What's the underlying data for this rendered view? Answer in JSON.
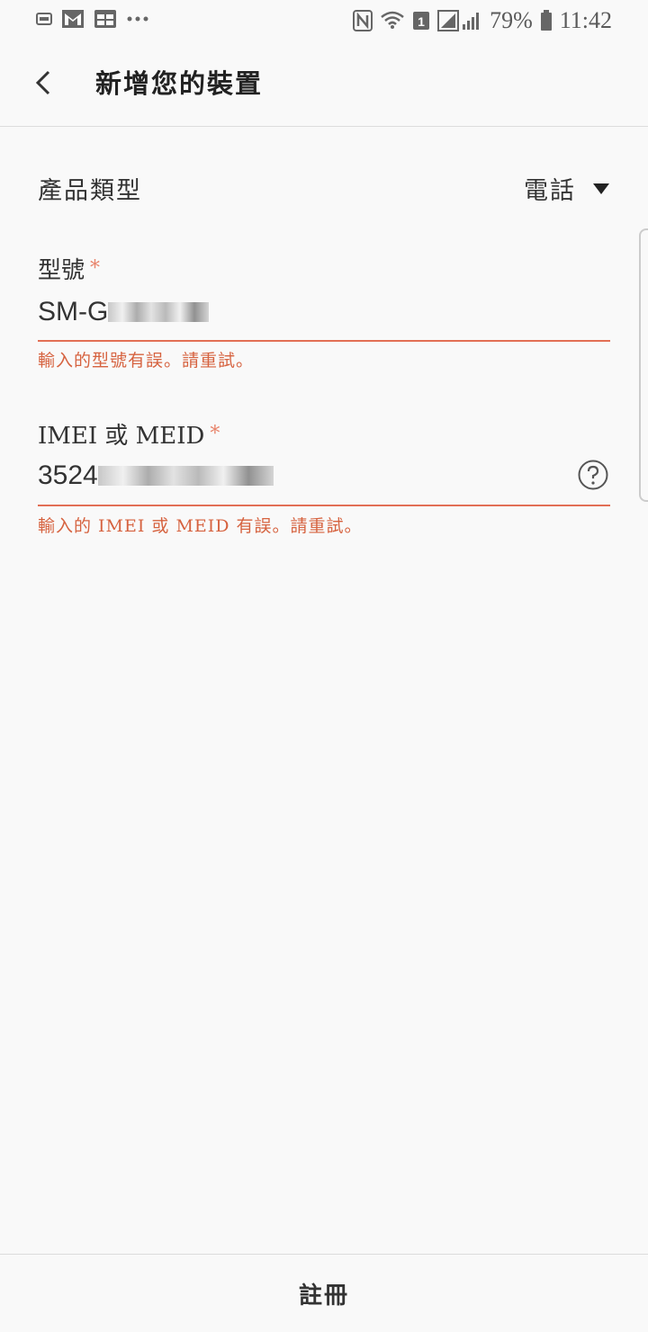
{
  "status_bar": {
    "battery": "79%",
    "time": "11:42",
    "left_icons": [
      "gallery-icon",
      "gmail-icon",
      "calendar-icon",
      "more-dots-icon"
    ],
    "right_icons": [
      "nfc-icon",
      "wifi-icon",
      "sim1-icon",
      "signal-icon",
      "battery-icon"
    ]
  },
  "appbar": {
    "title": "新增您的裝置",
    "back_icon": "back-arrow-icon"
  },
  "product_type": {
    "label": "產品類型",
    "value": "電話"
  },
  "model_field": {
    "label": "型號",
    "required_mark": "*",
    "value": "SM-G",
    "error": "輸入的型號有誤。請重試。"
  },
  "imei_field": {
    "label": "IMEI 或 MEID",
    "required_mark": "*",
    "value": "3524",
    "error": "輸入的 IMEI 或 MEID 有誤。請重試。",
    "help_icon": "help-circle-icon"
  },
  "bottom": {
    "register_label": "註冊"
  },
  "colors": {
    "background": "#f9f9f9",
    "error": "#d6623f",
    "underline": "#e26f55",
    "text": "#252525"
  }
}
